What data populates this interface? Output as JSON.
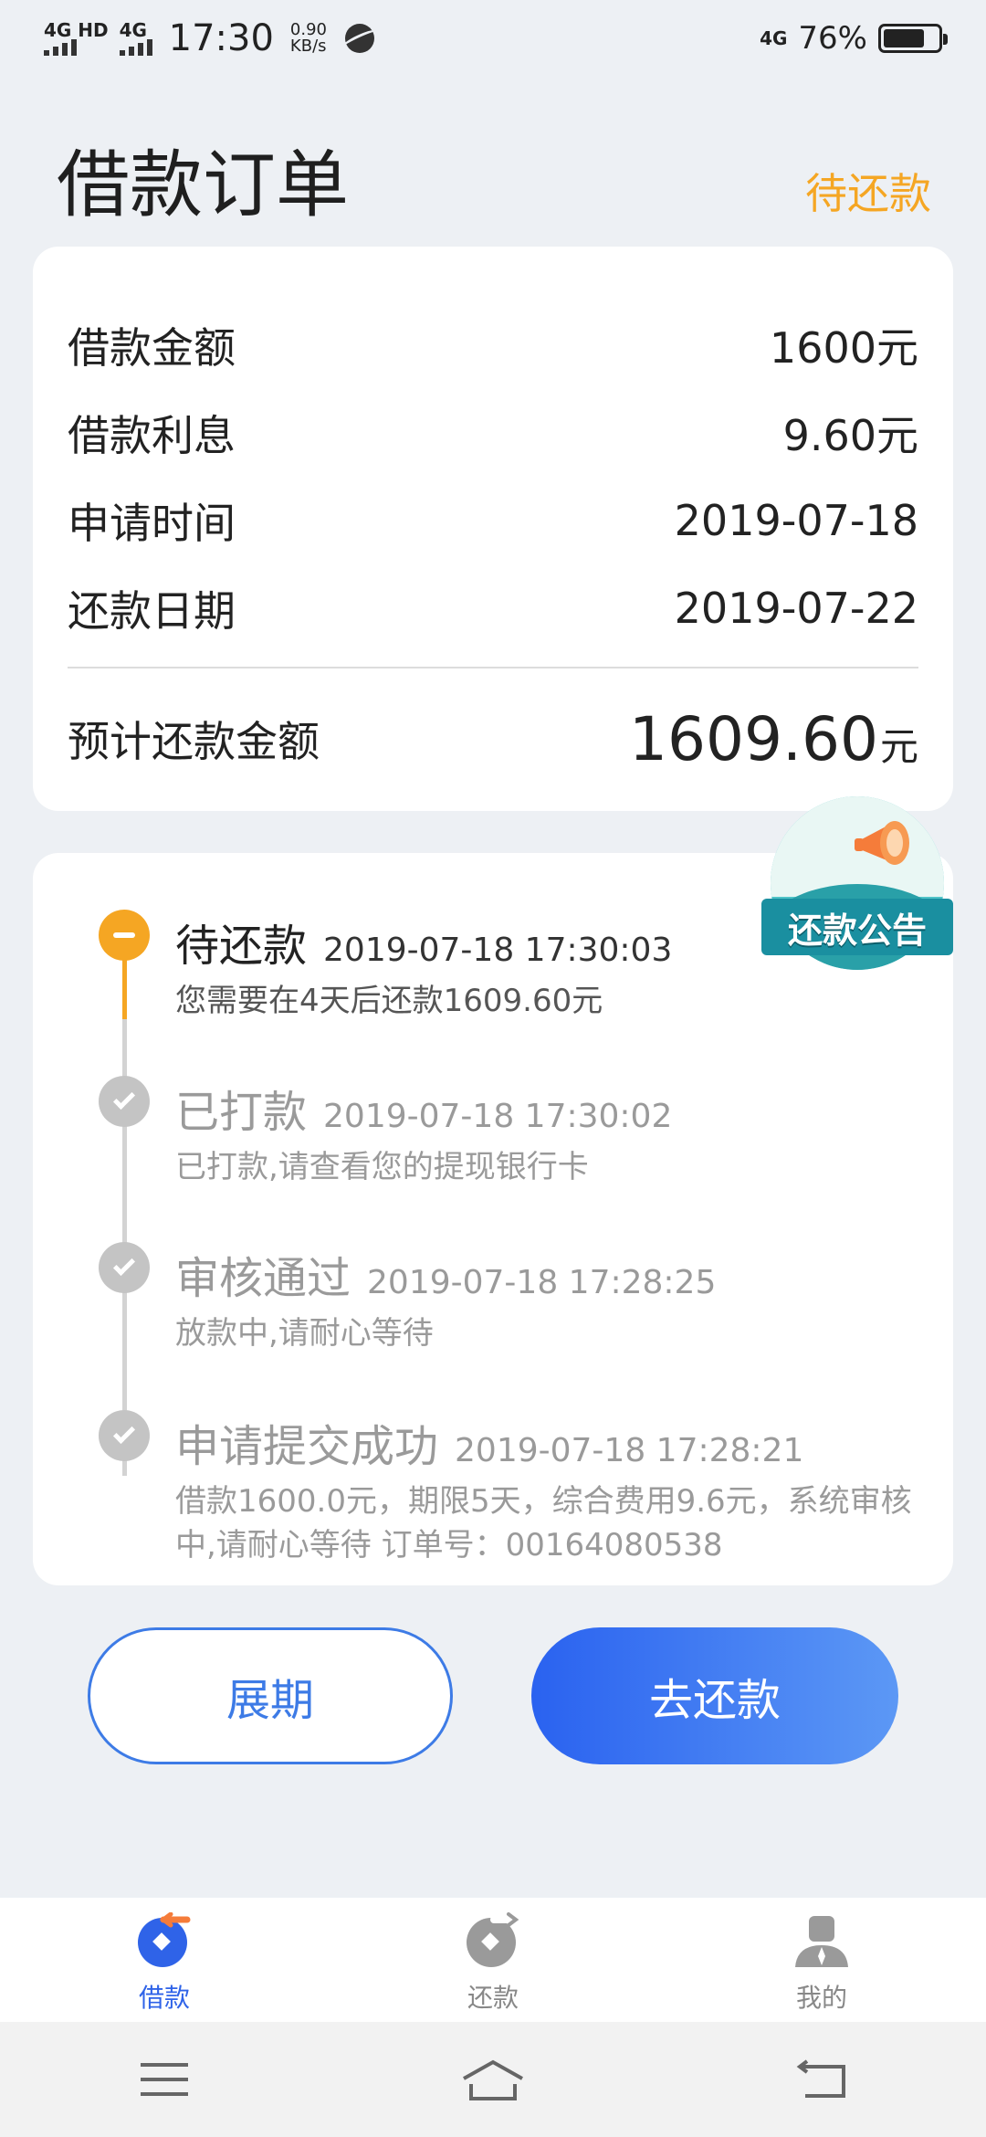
{
  "status_bar": {
    "sim1": "4G HD",
    "sim2": "4G",
    "time": "17:30",
    "speed_value": "0.90",
    "speed_unit": "KB/s",
    "net": "4G",
    "battery": "76%",
    "battery_level": 0.76
  },
  "header": {
    "title": "借款订单",
    "status": "待还款"
  },
  "summary": {
    "rows": [
      {
        "label": "借款金额",
        "value": "1600元"
      },
      {
        "label": "借款利息",
        "value": "9.60元"
      },
      {
        "label": "申请时间",
        "value": "2019-07-18"
      },
      {
        "label": "还款日期",
        "value": "2019-07-22"
      }
    ],
    "total_label": "预计还款金额",
    "total_value": "1609.60",
    "total_unit": "元"
  },
  "announcement": {
    "label": "还款公告"
  },
  "timeline": [
    {
      "title": "待还款",
      "time": "2019-07-18 17:30:03",
      "desc": "您需要在4天后还款1609.60元",
      "state": "current"
    },
    {
      "title": "已打款",
      "time": "2019-07-18 17:30:02",
      "desc": "已打款,请查看您的提现银行卡",
      "state": "done"
    },
    {
      "title": "审核通过",
      "time": "2019-07-18 17:28:25",
      "desc": "放款中,请耐心等待",
      "state": "done"
    },
    {
      "title": "申请提交成功",
      "time": "2019-07-18 17:28:21",
      "desc": "借款1600.0元，期限5天，综合费用9.6元，系统审核中,请耐心等待 订单号：00164080538",
      "state": "done"
    }
  ],
  "actions": {
    "extend_label": "展期",
    "repay_label": "去还款"
  },
  "bottom_nav": [
    {
      "label": "借款",
      "icon": "borrow-icon",
      "active": true
    },
    {
      "label": "还款",
      "icon": "repay-icon",
      "active": false
    },
    {
      "label": "我的",
      "icon": "profile-icon",
      "active": false
    }
  ],
  "colors": {
    "accent": "#2f63e8",
    "pending": "#f5a623",
    "muted": "#9a9a9a"
  }
}
